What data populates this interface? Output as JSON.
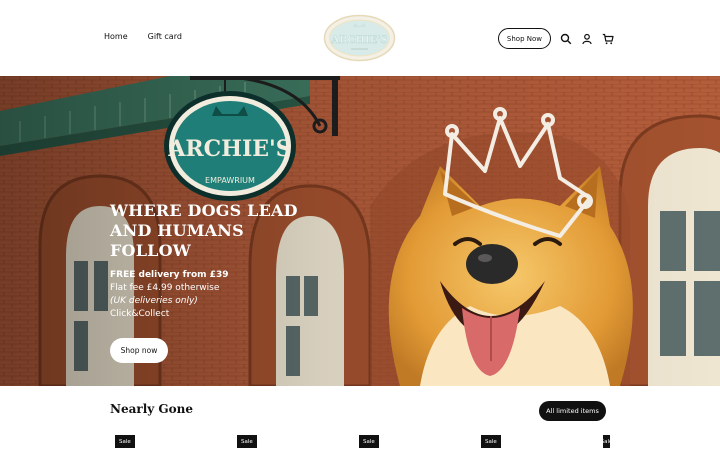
{
  "header": {
    "nav": [
      {
        "label": "Home"
      },
      {
        "label": "Gift card"
      }
    ],
    "logo": {
      "text": "ARCHIE'S",
      "subtext": "EMPAWRIUM"
    },
    "shop_button": "Shop Now",
    "icons": [
      "search-icon",
      "account-icon",
      "cart-icon"
    ]
  },
  "hero": {
    "sign": {
      "title": "ARCHIE'S",
      "subtitle": "EMPAWRIUM"
    },
    "title_lines": [
      "WHERE DOGS LEAD",
      "AND HUMANS",
      "FOLLOW"
    ],
    "delivery": "FREE delivery from £39",
    "flat_fee": "Flat fee £4.99 otherwise",
    "uk_only": "(UK deliveries only)",
    "click_collect": "Click&Collect",
    "button": "Shop now"
  },
  "section": {
    "title": "Nearly Gone",
    "all_button": "All limited items",
    "badges": [
      "Sale",
      "Sale",
      "Sale",
      "Sale",
      "Sale"
    ]
  },
  "colors": {
    "brick": "#b5603e",
    "teal": "#1f7f78",
    "dog": "#e3a33c",
    "black": "#111111"
  }
}
